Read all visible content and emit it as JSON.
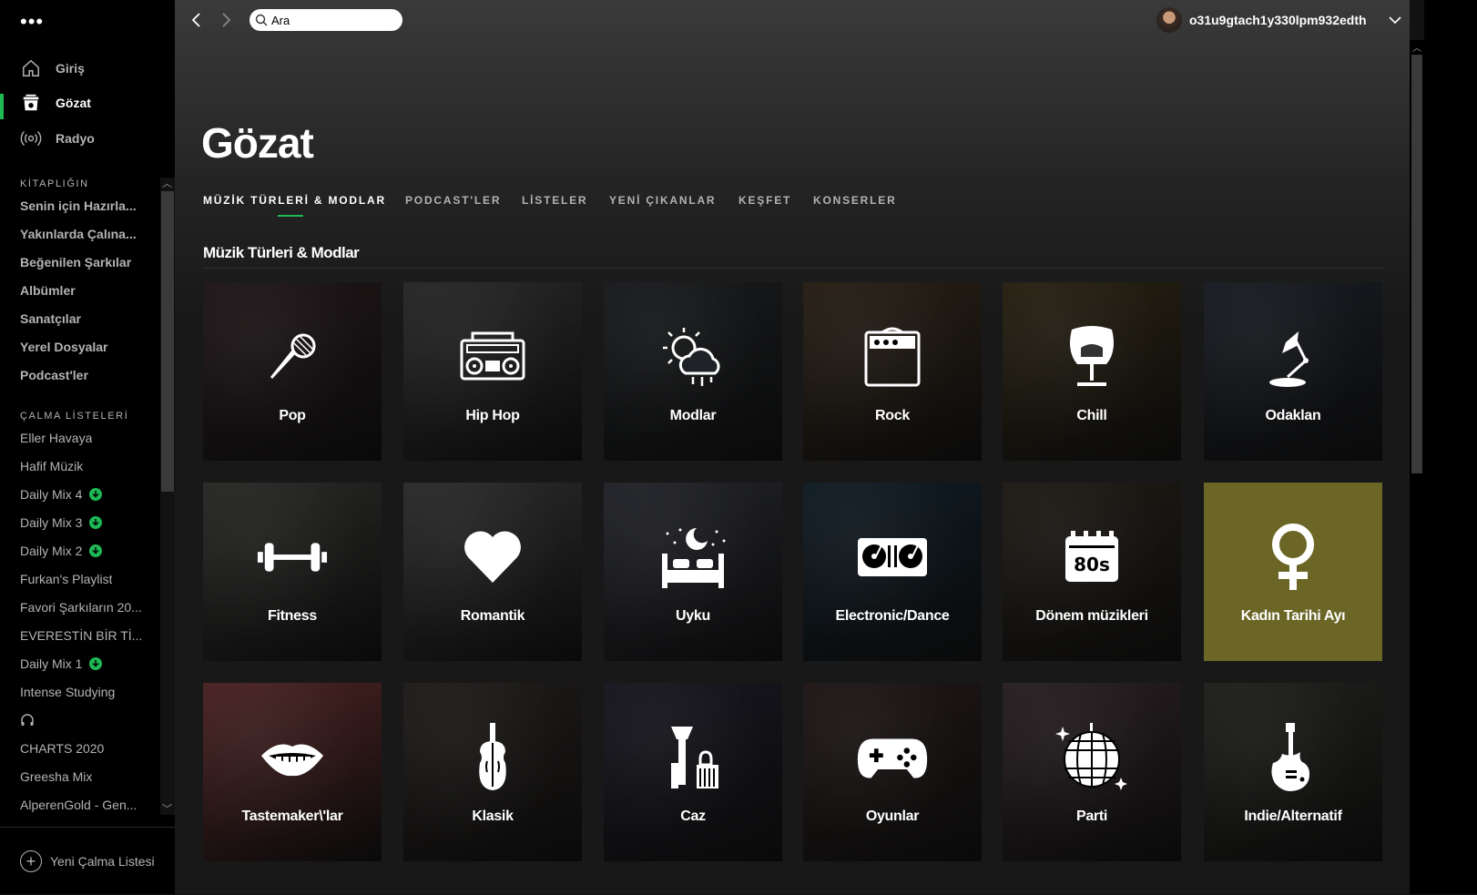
{
  "sidebar": {
    "menu_glyph": "•••",
    "nav": [
      {
        "label": "Giriş",
        "icon": "home-icon"
      },
      {
        "label": "Gözat",
        "icon": "browse-icon",
        "active": true
      },
      {
        "label": "Radyo",
        "icon": "radio-icon"
      }
    ],
    "library_title": "KİTAPLIĞIN",
    "library": [
      "Senin için Hazırla...",
      "Yakınlarda Çalına...",
      "Beğenilen Şarkılar",
      "Albümler",
      "Sanatçılar",
      "Yerel Dosyalar",
      "Podcast'ler"
    ],
    "playlists_title": "ÇALMA LİSTELERİ",
    "playlists": [
      {
        "label": "Eller Havaya",
        "downloaded": false
      },
      {
        "label": "Hafif Müzik",
        "downloaded": false
      },
      {
        "label": "Daily Mix 4",
        "downloaded": true
      },
      {
        "label": "Daily Mix 3",
        "downloaded": true
      },
      {
        "label": "Daily Mix 2",
        "downloaded": true
      },
      {
        "label": "Furkan's Playlist",
        "downloaded": false
      },
      {
        "label": "Favori Şarkıların 20...",
        "downloaded": false
      },
      {
        "label": "EVERESTİN BİR Tİ...",
        "downloaded": false
      },
      {
        "label": "Daily Mix 1",
        "downloaded": true
      },
      {
        "label": "Intense Studying",
        "downloaded": false
      },
      {
        "label": "",
        "downloaded": false,
        "icon": "headphones-icon"
      },
      {
        "label": "CHARTS 2020",
        "downloaded": false
      },
      {
        "label": "Greesha Mix",
        "downloaded": false
      },
      {
        "label": "AlperenGold - Gen...",
        "downloaded": false
      }
    ],
    "new_playlist": "Yeni Çalma Listesi"
  },
  "topbar": {
    "search_value": "Ara",
    "username": "o31u9gtach1y330lpm932edth"
  },
  "page_title": "Gözat",
  "tabs": [
    "MÜZİK TÜRLERİ & MODLAR",
    "PODCAST'LER",
    "LİSTELER",
    "YENİ ÇIKANLAR",
    "KEŞFET",
    "KONSERLER"
  ],
  "section_title": "Müzik Türleri & Modlar",
  "tiles": [
    {
      "label": "Pop",
      "icon": "microphone-icon",
      "color": "#3a2a2e"
    },
    {
      "label": "Hip Hop",
      "icon": "boombox-icon",
      "color": "#4a4a4a"
    },
    {
      "label": "Modlar",
      "icon": "weather-icon",
      "color": "#2e3236"
    },
    {
      "label": "Rock",
      "icon": "amplifier-icon",
      "color": "#4a3a28"
    },
    {
      "label": "Chill",
      "icon": "egg-chair-icon",
      "color": "#4a3e22"
    },
    {
      "label": "Odaklan",
      "icon": "desk-lamp-icon",
      "color": "#2e3440"
    },
    {
      "label": "Fitness",
      "icon": "dumbbell-icon",
      "color": "#4a4a46"
    },
    {
      "label": "Romantik",
      "icon": "heart-icon",
      "color": "#505050"
    },
    {
      "label": "Uyku",
      "icon": "bed-icon",
      "color": "#40424c"
    },
    {
      "label": "Electronic/Dance",
      "icon": "turntable-icon",
      "color": "#1e3444"
    },
    {
      "label": "Dönem müzikleri",
      "icon": "calendar-80s-icon",
      "color": "#3a3228"
    },
    {
      "label": "Kadın Tarihi Ayı",
      "icon": "female-symbol-icon",
      "color": "#6b6626"
    },
    {
      "label": "Tastemaker\\'lar",
      "icon": "lips-icon",
      "color": "#8a4040"
    },
    {
      "label": "Klasik",
      "icon": "violin-icon",
      "color": "#3a3430"
    },
    {
      "label": "Caz",
      "icon": "brass-instrument-icon",
      "color": "#2c2a3a"
    },
    {
      "label": "Oyunlar",
      "icon": "gamepad-icon",
      "color": "#3a2a2a"
    },
    {
      "label": "Parti",
      "icon": "disco-ball-icon",
      "color": "#4a3a40"
    },
    {
      "label": "Indie/Alternatif",
      "icon": "guitar-icon",
      "color": "#3a3a34"
    }
  ],
  "colors": {
    "accent": "#1db954",
    "sidebar_bg": "#000000",
    "main_bg": "#181818"
  }
}
